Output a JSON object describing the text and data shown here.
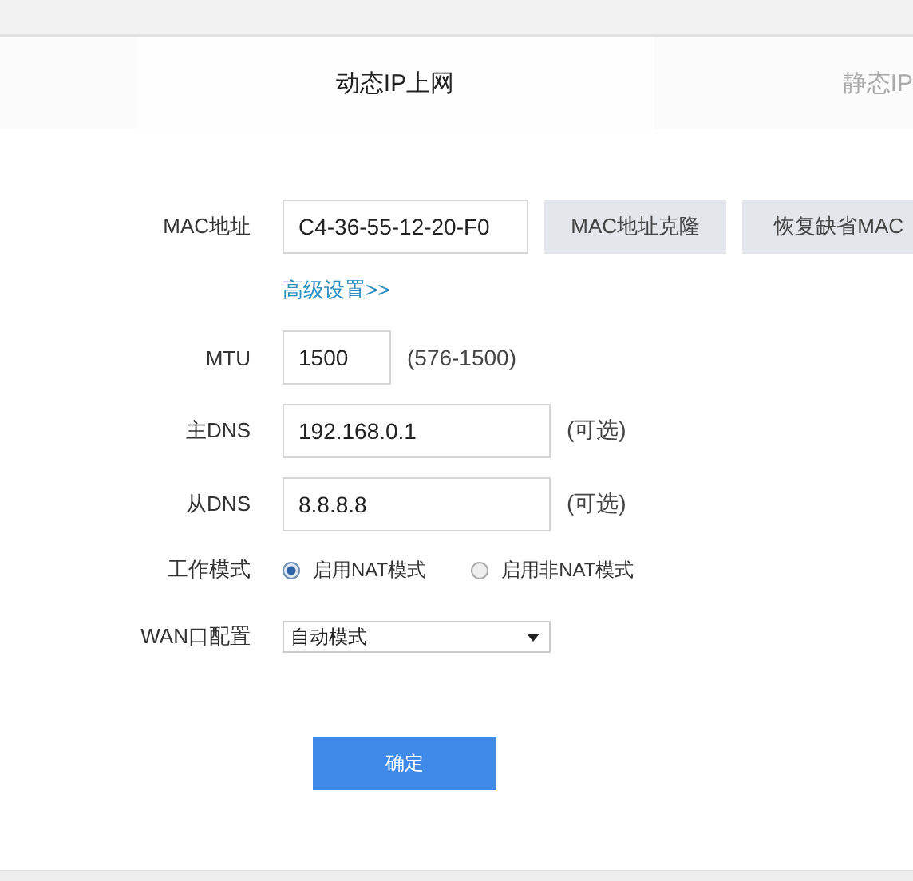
{
  "tabs": [
    {
      "label": "动态IP上网",
      "selected": true
    },
    {
      "label": "静态IP",
      "selected": false
    }
  ],
  "mac": {
    "label": "MAC地址",
    "value": "C4-36-55-12-20-F0",
    "buttons": [
      "MAC地址克隆",
      "恢复缺省MAC"
    ]
  },
  "advanced_link": "高级设置>>",
  "fields": [
    {
      "label": "MTU",
      "value": "1500",
      "hint": "(576-1500)",
      "kind": "short"
    },
    {
      "label": "主DNS",
      "value": "192.168.0.1",
      "hint": "(可选)",
      "kind": "long"
    },
    {
      "label": "从DNS",
      "value": "8.8.8.8",
      "hint": "(可选)",
      "kind": "long"
    }
  ],
  "work_mode": {
    "label": "工作模式",
    "options": [
      {
        "label": "启用NAT模式",
        "selected": true
      },
      {
        "label": "启用非NAT模式",
        "selected": false
      }
    ]
  },
  "wan": {
    "label": "WAN口配置",
    "value": "自动模式"
  },
  "confirm_button": "确定"
}
